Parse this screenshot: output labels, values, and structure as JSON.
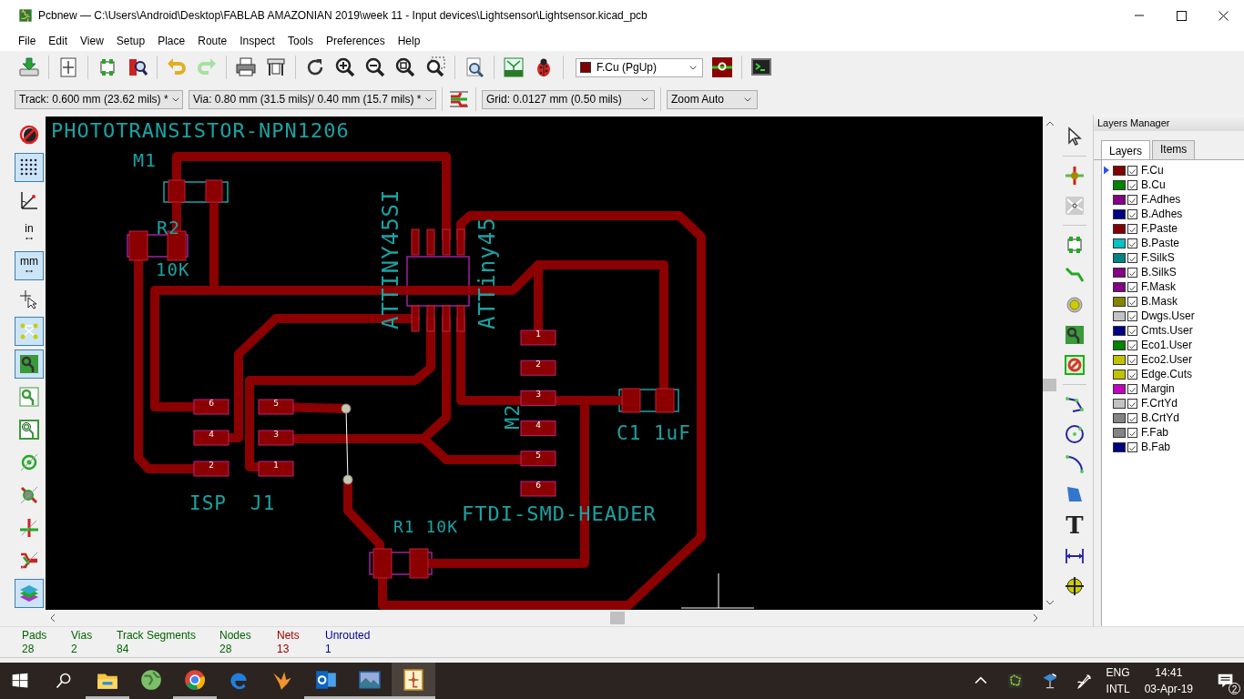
{
  "window": {
    "title": "Pcbnew — C:\\Users\\Android\\Desktop\\FABLAB AMAZONIAN 2019\\week 11 - Input devices\\Lightsensor\\Lightsensor.kicad_pcb"
  },
  "menu": [
    "File",
    "Edit",
    "View",
    "Setup",
    "Place",
    "Route",
    "Inspect",
    "Tools",
    "Preferences",
    "Help"
  ],
  "layer_select": {
    "value": "F.Cu (PgUp)",
    "color": "#800000"
  },
  "track_select": {
    "value": "Track: 0.600 mm (23.62 mils) *"
  },
  "via_select": {
    "value": "Via: 0.80 mm (31.5 mils)/ 0.40 mm (15.7 mils) *"
  },
  "grid_select": {
    "value": "Grid: 0.0127 mm (0.50 mils)"
  },
  "zoom_select": {
    "value": "Zoom Auto"
  },
  "left_toolbar": [
    {
      "kind": "drc-off",
      "on": false
    },
    {
      "kind": "grid",
      "on": true
    },
    {
      "kind": "polar",
      "on": false
    },
    {
      "kind": "units",
      "label": "in",
      "on": false
    },
    {
      "kind": "units",
      "label": "mm",
      "on": true
    },
    {
      "kind": "cursor",
      "on": false
    },
    {
      "kind": "ratsnest",
      "on": true
    },
    {
      "kind": "zone-fill",
      "on": true
    },
    {
      "kind": "zone-outline",
      "on": false
    },
    {
      "kind": "zone-sketch",
      "on": false
    },
    {
      "kind": "pad-sketch",
      "on": false
    },
    {
      "kind": "via-sketch",
      "on": false
    },
    {
      "kind": "track-sketch",
      "on": false
    },
    {
      "kind": "high-contrast",
      "on": false
    },
    {
      "kind": "layers",
      "on": true
    }
  ],
  "board": {
    "labels": [
      "PHOTOTRANSISTOR-NPN1206",
      "M1",
      "R2",
      "10K",
      "ATTINY45SI",
      "ATTiny45",
      "M2",
      "C1 1uF",
      "ISP",
      "J1",
      "R1 10K",
      "FTDI-SMD-HEADER"
    ],
    "isp_pads": [
      "6",
      "4",
      "2"
    ],
    "j1_pads": [
      "5",
      "3",
      "1"
    ],
    "ftdi_pads": [
      "1",
      "2",
      "3",
      "4",
      "5",
      "6"
    ]
  },
  "right_toolbar": {
    "text_glyph": "T"
  },
  "layers_manager": {
    "title": "Layers Manager",
    "tabs": [
      {
        "label": "Layers",
        "selected": true
      },
      {
        "label": "Items",
        "selected": false
      }
    ],
    "layers": [
      {
        "name": "F.Cu",
        "color": "#840000",
        "checked": true,
        "selected": true
      },
      {
        "name": "B.Cu",
        "color": "#008400",
        "checked": true,
        "selected": false
      },
      {
        "name": "F.Adhes",
        "color": "#840084",
        "checked": true,
        "selected": false
      },
      {
        "name": "B.Adhes",
        "color": "#000084",
        "checked": true,
        "selected": false
      },
      {
        "name": "F.Paste",
        "color": "#840000",
        "checked": true,
        "selected": false
      },
      {
        "name": "B.Paste",
        "color": "#00c2c2",
        "checked": true,
        "selected": false
      },
      {
        "name": "F.SilkS",
        "color": "#008484",
        "checked": true,
        "selected": false
      },
      {
        "name": "B.SilkS",
        "color": "#840084",
        "checked": true,
        "selected": false
      },
      {
        "name": "F.Mask",
        "color": "#840084",
        "checked": true,
        "selected": false
      },
      {
        "name": "B.Mask",
        "color": "#848400",
        "checked": true,
        "selected": false
      },
      {
        "name": "Dwgs.User",
        "color": "#c2c2c2",
        "checked": true,
        "selected": false
      },
      {
        "name": "Cmts.User",
        "color": "#000084",
        "checked": true,
        "selected": false
      },
      {
        "name": "Eco1.User",
        "color": "#008400",
        "checked": true,
        "selected": false
      },
      {
        "name": "Eco2.User",
        "color": "#c2c200",
        "checked": true,
        "selected": false
      },
      {
        "name": "Edge.Cuts",
        "color": "#c2c200",
        "checked": true,
        "selected": false
      },
      {
        "name": "Margin",
        "color": "#c200c2",
        "checked": true,
        "selected": false
      },
      {
        "name": "F.CrtYd",
        "color": "#c2c2c2",
        "checked": true,
        "selected": false
      },
      {
        "name": "B.CrtYd",
        "color": "#848484",
        "checked": true,
        "selected": false
      },
      {
        "name": "F.Fab",
        "color": "#848484",
        "checked": true,
        "selected": false
      },
      {
        "name": "B.Fab",
        "color": "#000084",
        "checked": true,
        "selected": false
      }
    ]
  },
  "status": [
    {
      "label": "Pads",
      "value": "28",
      "color": "#006400"
    },
    {
      "label": "Vias",
      "value": "2",
      "color": "#006400"
    },
    {
      "label": "Track Segments",
      "value": "84",
      "color": "#006400"
    },
    {
      "label": "Nodes",
      "value": "28",
      "color": "#006400"
    },
    {
      "label": "Nets",
      "value": "13",
      "color": "#a00000"
    },
    {
      "label": "Unrouted",
      "value": "1",
      "color": "#000096"
    }
  ],
  "taskbar": {
    "apps": [
      {
        "kind": "explorer",
        "running": true,
        "selected": false
      },
      {
        "kind": "globe",
        "running": false,
        "selected": false
      },
      {
        "kind": "chrome",
        "running": true,
        "selected": false
      },
      {
        "kind": "edge",
        "running": false,
        "selected": false
      },
      {
        "kind": "bird",
        "running": false,
        "selected": false
      },
      {
        "kind": "outlook",
        "running": true,
        "selected": false
      },
      {
        "kind": "photos",
        "running": true,
        "selected": false
      },
      {
        "kind": "kicad",
        "running": true,
        "selected": true
      }
    ],
    "language": "ENG",
    "layout": "INTL",
    "time": "14:41",
    "date": "03-Apr-19",
    "notifications": "2"
  }
}
